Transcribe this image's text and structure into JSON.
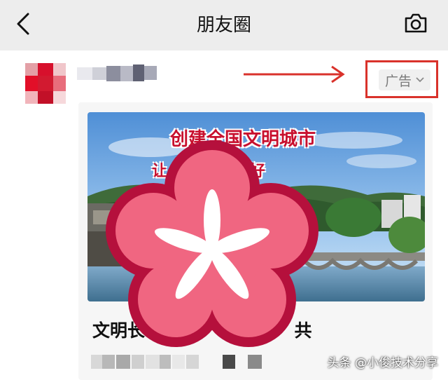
{
  "header": {
    "title": "朋友圈",
    "back_icon": "chevron-left-icon",
    "camera_icon": "camera-icon"
  },
  "post": {
    "ad_label": "广告",
    "banner": {
      "headline": "创建全国文明城市",
      "slogan": "让 让城市更美好"
    },
    "title_partial": "文明长",
    "title_partial_2": "共"
  },
  "annotation": {
    "color": "#d9322b",
    "arrow_target": "ad-label-box"
  },
  "watermark": {
    "text": "头条 @小俊技术分享"
  },
  "colors": {
    "header_bg": "#ededed",
    "sticker_outer": "#b5103c",
    "sticker_inner": "#f06681",
    "sticker_center": "#ffffff"
  }
}
